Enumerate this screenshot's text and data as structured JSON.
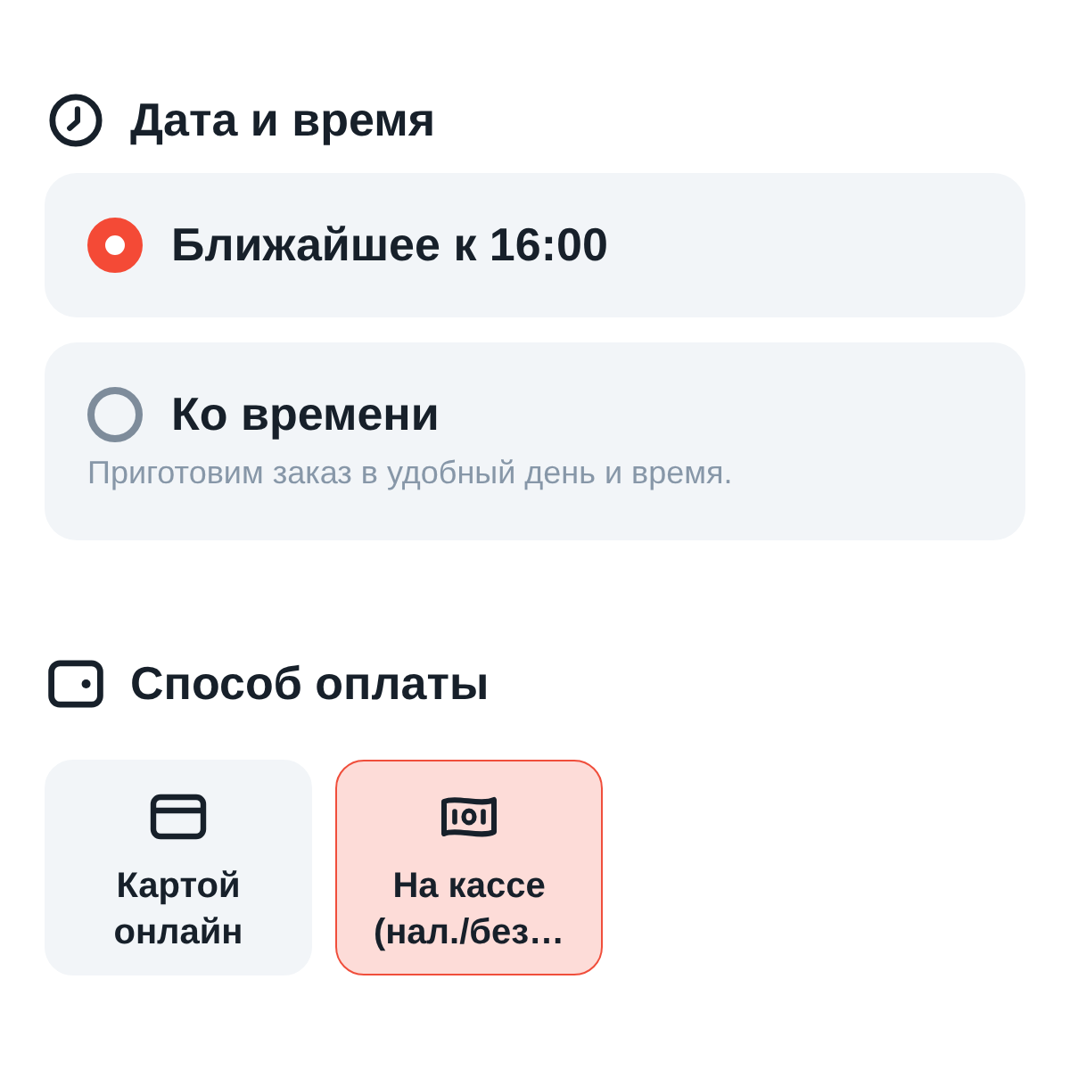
{
  "sections": [
    {
      "kind": "time",
      "title": "Дата и время",
      "options": [
        {
          "label": "Ближайшее к 16:00",
          "selected": true
        },
        {
          "label": "Ко времени",
          "description": "Приготовим заказ в удобный день и время.",
          "selected": false
        }
      ]
    },
    {
      "kind": "payment",
      "title": "Способ оплаты",
      "methods": [
        {
          "kind": "card",
          "label": "Картой онлайн",
          "selected": false
        },
        {
          "kind": "cash",
          "label": "На кассе (нал./без…",
          "selected": true
        }
      ]
    }
  ]
}
